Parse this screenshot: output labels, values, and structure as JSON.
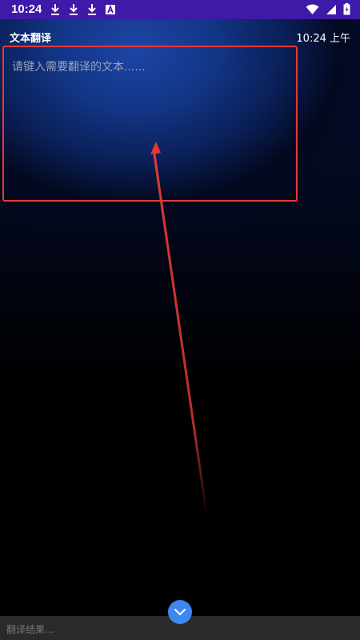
{
  "status_bar": {
    "time": "10:24",
    "left_icons": [
      "download-icon",
      "download-icon",
      "download-icon",
      "a-icon"
    ],
    "right_icons": [
      "wifi-icon",
      "signal-icon",
      "battery-icon"
    ],
    "background_color": "#3f19a8"
  },
  "header": {
    "title": "文本翻译",
    "clock": "10:24 上午"
  },
  "input": {
    "placeholder": "请键入需要翻译的文本......",
    "value": ""
  },
  "annotation": {
    "type": "arrow",
    "color": "#e53935",
    "highlight_color": "#e53935"
  },
  "expand_button": {
    "icon": "chevron-down-icon",
    "color": "#3f86ee"
  },
  "result": {
    "placeholder": "翻译结果..."
  }
}
